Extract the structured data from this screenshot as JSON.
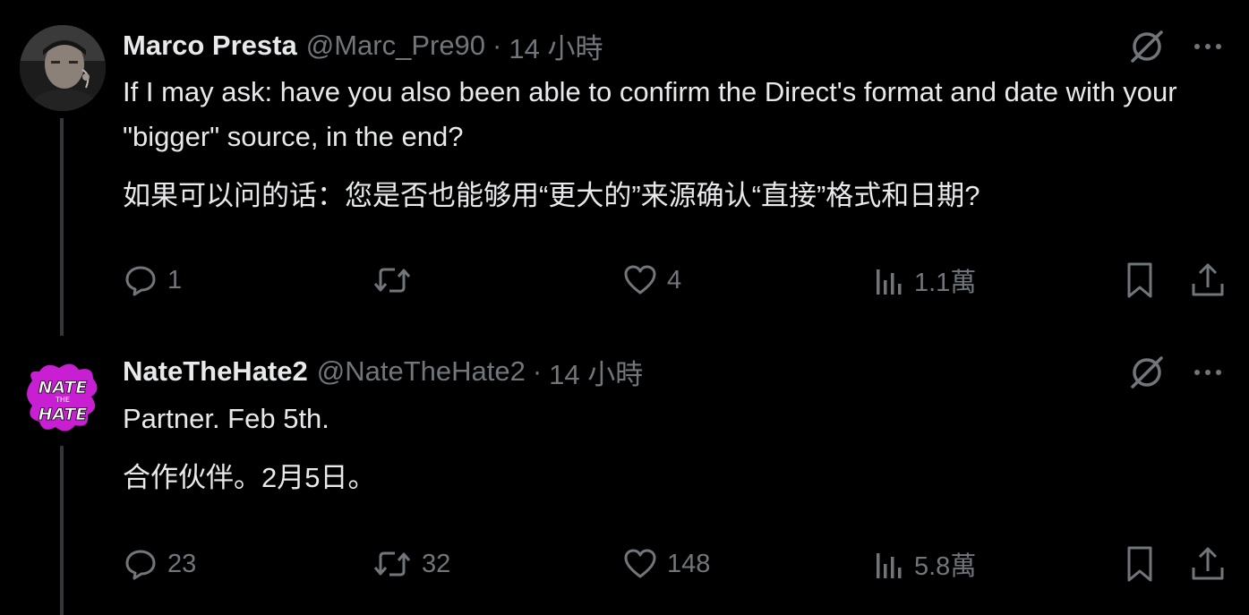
{
  "tweets": [
    {
      "display_name": "Marco Presta",
      "handle": "@Marc_Pre90",
      "separator": "·",
      "time": "14 小時",
      "text_en": "If I may ask: have you also been able to confirm the Direct's format and date with your \"bigger\" source, in the end?",
      "text_zh": "如果可以问的话：您是否也能够用“更大的”来源确认“直接”格式和日期?",
      "stats": {
        "replies": "1",
        "retweets": "",
        "likes": "4",
        "views": "1.1萬"
      },
      "icons": {
        "translate": "slashed-circle-icon",
        "more": "more-dots-icon",
        "reply": "reply-bubble-icon",
        "retweet": "retweet-icon",
        "like": "heart-icon",
        "views": "bar-chart-icon",
        "bookmark": "bookmark-icon",
        "share": "share-icon"
      }
    },
    {
      "display_name": "NateTheHate2",
      "handle": "@NateTheHate2",
      "separator": "·",
      "time": "14 小時",
      "avatar_text": "NATE THE HATE",
      "text_en": "Partner. Feb 5th.",
      "text_zh": "合作伙伴。2月5日。",
      "stats": {
        "replies": "23",
        "retweets": "32",
        "likes": "148",
        "views": "5.8萬"
      }
    }
  ],
  "colors": {
    "background": "#000000",
    "primary_text": "#e7e9ea",
    "secondary_text": "#71767b",
    "thread_line": "#333639",
    "avatar_accent": "#c71fd1"
  }
}
